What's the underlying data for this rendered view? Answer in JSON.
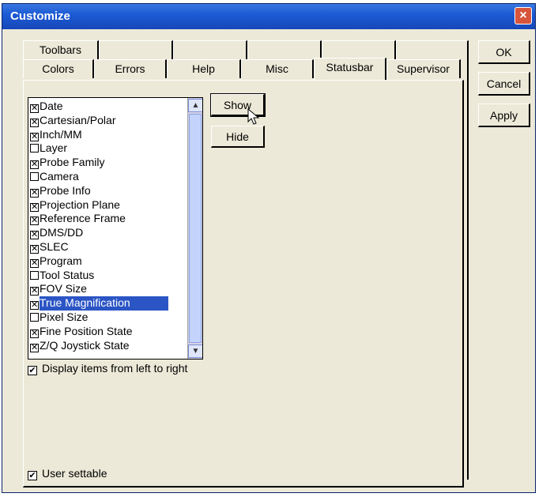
{
  "window": {
    "title": "Customize",
    "close_label": "×"
  },
  "tabs": {
    "back": [
      "Toolbars",
      "",
      "",
      "",
      "",
      ""
    ],
    "front": [
      "Colors",
      "Errors",
      "Help",
      "Misc",
      "Statusbar",
      "Supervisor"
    ]
  },
  "list": {
    "items": [
      {
        "label": "Date",
        "checked": true
      },
      {
        "label": "Cartesian/Polar",
        "checked": true
      },
      {
        "label": "Inch/MM",
        "checked": true
      },
      {
        "label": "Layer",
        "checked": false
      },
      {
        "label": "Probe Family",
        "checked": true
      },
      {
        "label": "Camera",
        "checked": false
      },
      {
        "label": "Probe Info",
        "checked": true
      },
      {
        "label": "Projection Plane",
        "checked": true
      },
      {
        "label": "Reference Frame",
        "checked": true
      },
      {
        "label": "DMS/DD",
        "checked": true
      },
      {
        "label": "SLEC",
        "checked": true
      },
      {
        "label": "Program",
        "checked": true
      },
      {
        "label": "Tool Status",
        "checked": false
      },
      {
        "label": "FOV Size",
        "checked": true
      },
      {
        "label": "True Magnification",
        "checked": true,
        "selected": true
      },
      {
        "label": "Pixel Size",
        "checked": false
      },
      {
        "label": "Fine Position State",
        "checked": true
      },
      {
        "label": "Z/Q Joystick State",
        "checked": true
      }
    ]
  },
  "buttons": {
    "show": "Show",
    "hide": "Hide",
    "ok": "OK",
    "cancel": "Cancel",
    "apply": "Apply"
  },
  "checkboxes": {
    "left_to_right": {
      "label": "Display items from left to right",
      "checked": true
    },
    "user_settable": {
      "label": "User settable",
      "checked": true
    }
  },
  "colors": {
    "selection": "#2b55c5",
    "titlebar": "#1c5bd5",
    "close": "#d8553c"
  }
}
